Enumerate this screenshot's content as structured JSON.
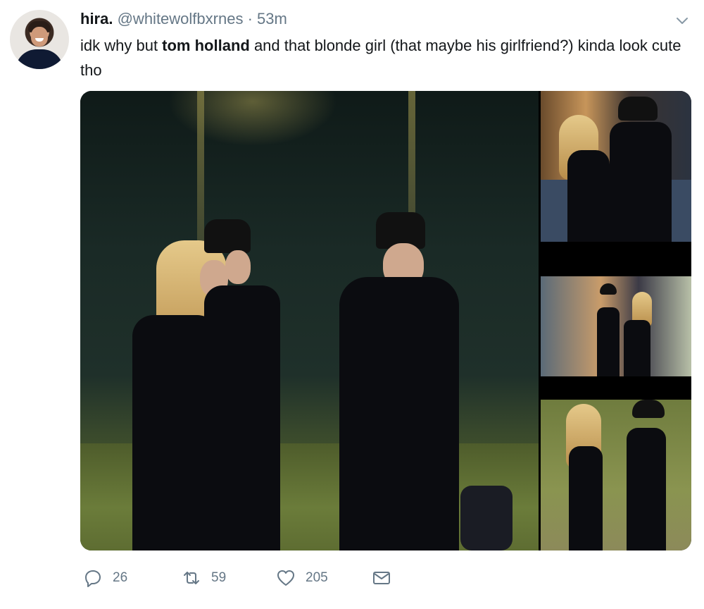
{
  "tweet": {
    "user": {
      "name": "hira.",
      "handle": "@whitewolfbxrnes"
    },
    "separator": "·",
    "time": "53m",
    "text": {
      "part1": "idk why but ",
      "bold": "tom holland",
      "part2": " and that blonde girl (that maybe his girlfriend?) kinda look cute tho"
    },
    "actions": {
      "reply": {
        "icon": "reply-icon",
        "count": "26"
      },
      "retweet": {
        "icon": "retweet-icon",
        "count": "59"
      },
      "like": {
        "icon": "heart-icon",
        "count": "205"
      },
      "dm": {
        "icon": "mail-icon"
      }
    }
  },
  "colors": {
    "text": "#14171a",
    "muted": "#657786",
    "background": "#ffffff"
  }
}
